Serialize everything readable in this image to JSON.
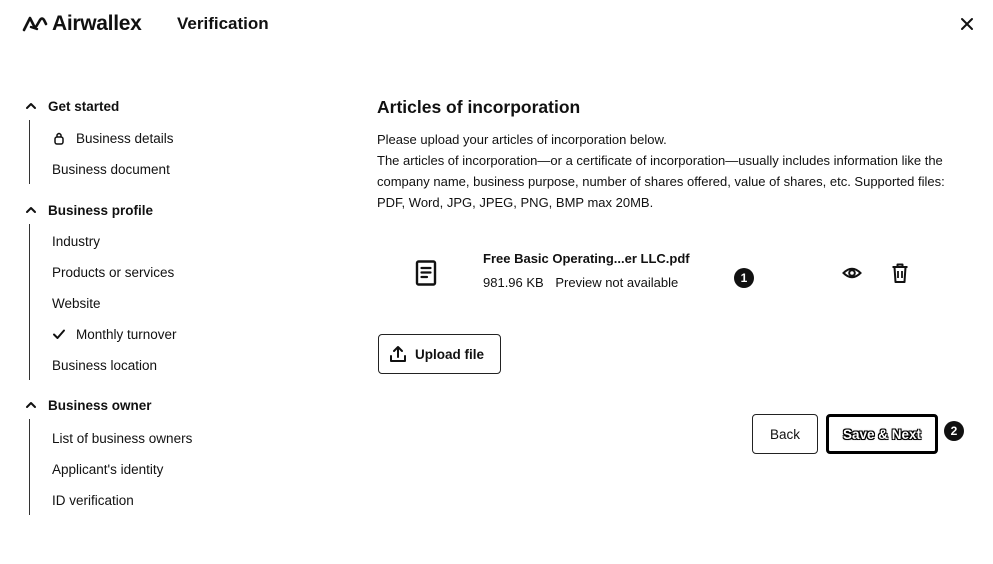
{
  "header": {
    "brand": "Airwallex",
    "title": "Verification",
    "logo_icon": "airwallex-logo-icon",
    "close_icon": "close-icon"
  },
  "sidebar": {
    "sections": [
      {
        "title": "Get started",
        "items": [
          {
            "label": "Business details",
            "icon": "lock-icon"
          },
          {
            "label": "Business document",
            "icon": ""
          }
        ]
      },
      {
        "title": "Business profile",
        "items": [
          {
            "label": "Industry",
            "icon": ""
          },
          {
            "label": "Products or services",
            "icon": ""
          },
          {
            "label": "Website",
            "icon": ""
          },
          {
            "label": "Monthly turnover",
            "icon": "check-icon"
          },
          {
            "label": "Business location",
            "icon": ""
          }
        ]
      },
      {
        "title": "Business owner",
        "items": [
          {
            "label": "List of business owners",
            "icon": ""
          },
          {
            "label": "Applicant's identity",
            "icon": ""
          },
          {
            "label": "ID verification",
            "icon": ""
          }
        ]
      }
    ]
  },
  "main": {
    "title": "Articles of incorporation",
    "description_line1": "Please upload your articles of incorporation below.",
    "description_line2": "The articles of incorporation—or a certificate of incorporation—usually includes information like the company name, business purpose, number of shares offered, value of shares, etc. Supported files: PDF, Word, JPG, JPEG, PNG, BMP max 20MB.",
    "file": {
      "name": "Free Basic Operating...er LLC.pdf",
      "size": "981.96 KB",
      "status": "Preview not available"
    },
    "upload_label": "Upload file",
    "back_label": "Back",
    "save_label": "Save & Next",
    "badges": [
      "1",
      "2"
    ]
  }
}
